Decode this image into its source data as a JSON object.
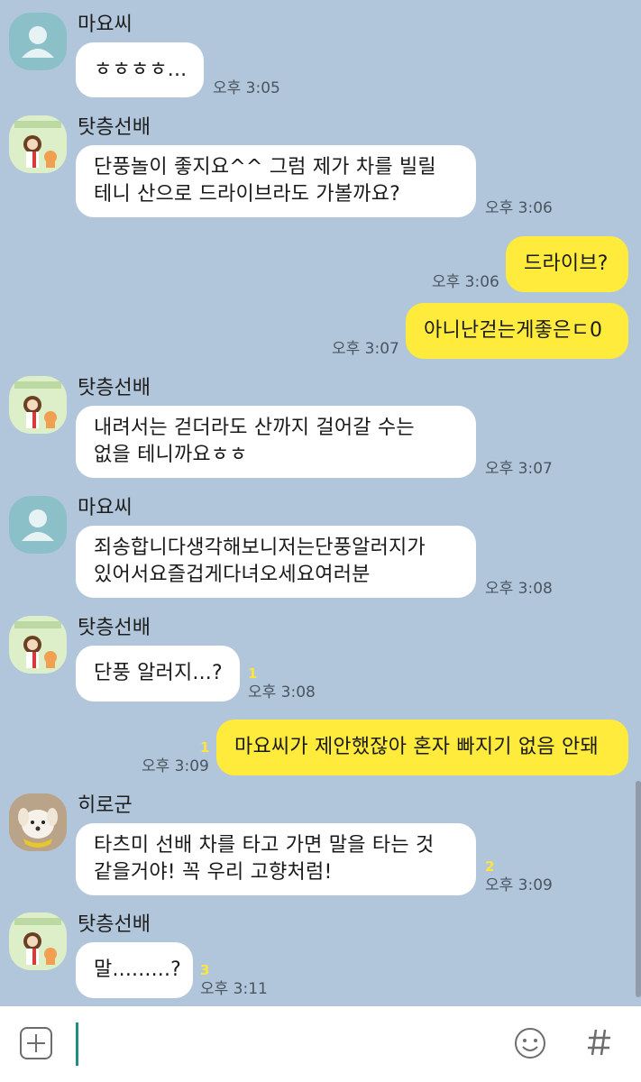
{
  "messages": [
    {
      "sender": "마요씨",
      "text": [
        "ㅎㅎㅎㅎ..."
      ],
      "time": "오후 3:05"
    },
    {
      "sender": "탓층선배",
      "text": [
        "단풍놀이 좋지요^^ 그럼 제가 차를 빌릴",
        "테니 산으로 드라이브라도 가볼까요?"
      ],
      "time": "오후 3:06"
    },
    {
      "text": "드라이브?",
      "time": "오후 3:06"
    },
    {
      "text": "아니난걷는게좋은ㄷ0",
      "time": "오후 3:07"
    },
    {
      "sender": "탓층선배",
      "text": [
        "내려서는 걷더라도 산까지 걸어갈 수는",
        "없을 테니까요ㅎㅎ"
      ],
      "time": "오후 3:07"
    },
    {
      "sender": "마요씨",
      "text": [
        "죄송합니다생각해보니저는단풍알러지가",
        "있어서요즐겁게다녀오세요여러분"
      ],
      "time": "오후 3:08"
    },
    {
      "sender": "탓층선배",
      "text": [
        "단풍 알러지...?"
      ],
      "time": "오후 3:08",
      "unread": "1"
    },
    {
      "text": "마요씨가 제안했잖아 혼자 빠지기 없음 안돼",
      "time": "오후 3:09",
      "unread": "1"
    },
    {
      "sender": "히로군",
      "text": [
        "타츠미 선배 차를 타고 가면 말을 타는 것",
        "같을거야! 꼭 우리 고향처럼!"
      ],
      "time": "오후 3:09",
      "unread": "2"
    },
    {
      "sender": "탓층선배",
      "text": [
        "말.........?"
      ],
      "time": "오후 3:11",
      "unread": "3"
    }
  ],
  "input": {
    "value": ""
  },
  "icons": {
    "attach": "plus-square-icon",
    "emoji": "smiley-icon",
    "hash": "hash-icon"
  },
  "colors": {
    "background": "#b1c6da",
    "my_bubble": "#ffeb3b",
    "their_bubble": "#ffffff",
    "unread": "#ffe53b"
  }
}
